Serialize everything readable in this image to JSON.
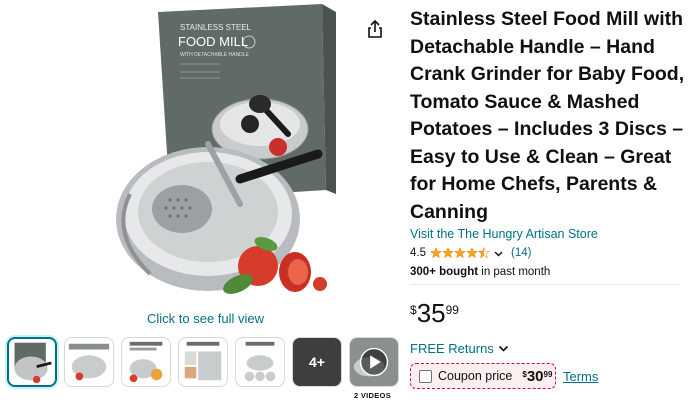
{
  "product": {
    "title": "Stainless Steel Food Mill with Detachable Handle – Hand Crank Grinder for Baby Food, Tomato Sauce & Mashed Potatoes – Includes 3 Discs – Easy to Use & Clean – Great for Home Chefs, Parents & Canning",
    "store_link": "Visit the The Hungry Artisan Store",
    "rating": "4.5",
    "rating_value": 4.5,
    "review_count": "(14)",
    "bought_bold": "300+ bought",
    "bought_rest": " in past month"
  },
  "price": {
    "symbol": "$",
    "whole": "35",
    "fraction": "99"
  },
  "returns": {
    "label": "FREE Returns"
  },
  "coupon": {
    "label": "Coupon price",
    "symbol": "$",
    "whole": "30",
    "fraction": "99",
    "terms": "Terms"
  },
  "gallery": {
    "full_view_link": "Click to see full view",
    "box_brand": "STAINLESS STEEL",
    "box_title": "FOOD MILL",
    "box_sub": "WITH DETACHABLE HANDLE",
    "more_count": "4+",
    "videos_label": "2 VIDEOS"
  },
  "colors": {
    "link": "#007185",
    "star": "#ffa41c",
    "coupon_border": "#cc0c39",
    "coupon_bg": "#fdeef0"
  },
  "icons": {
    "share": "share-icon",
    "chevron": "chevron-down-icon",
    "play": "play-icon"
  }
}
